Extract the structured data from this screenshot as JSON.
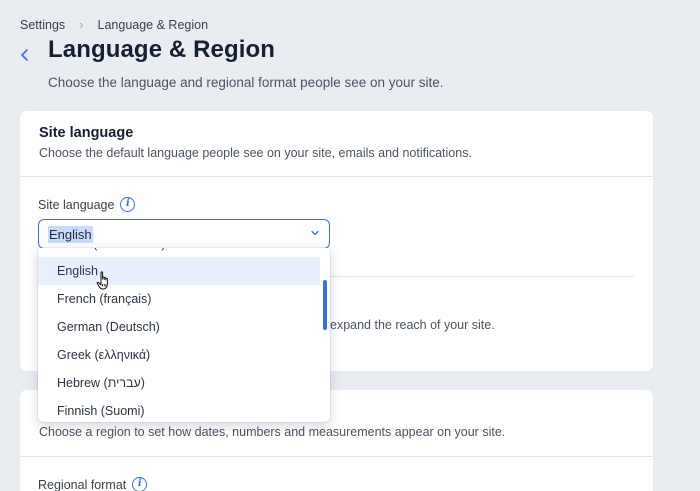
{
  "breadcrumb": {
    "root": "Settings",
    "current": "Language & Region"
  },
  "header": {
    "title": "Language & Region",
    "subtitle": "Choose the language and regional format people see on your site."
  },
  "site_language_card": {
    "title": "Site language",
    "description": "Choose the default language people see on your site, emails and notifications.",
    "field_label": "Site language",
    "selected_value": "English",
    "obscured_text": "expand the reach of your site."
  },
  "dropdown": {
    "options": [
      {
        "label": "Dutch (Nederlands)"
      },
      {
        "label": "English"
      },
      {
        "label": "French (français)"
      },
      {
        "label": "German (Deutsch)"
      },
      {
        "label": "Greek (ελληνικά)"
      },
      {
        "label": "Hebrew (עברית)"
      },
      {
        "label": "Finnish (Suomi)"
      }
    ]
  },
  "region_card": {
    "description": "Choose a region to set how dates, numbers and measurements appear on your site.",
    "field_label": "Regional format"
  },
  "colors": {
    "accent": "#3b6fe0",
    "background": "#e9edf2",
    "selected_option": "#e8f0fd"
  }
}
